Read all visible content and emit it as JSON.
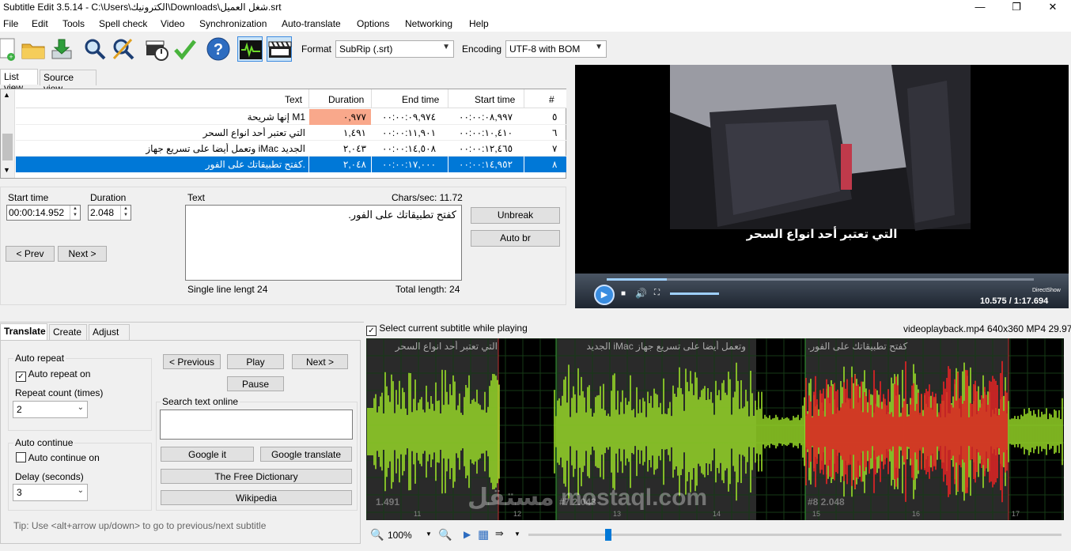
{
  "window": {
    "title": "Subtitle Edit 3.5.14 - C:\\Users\\الكترونيك\\Downloads\\شغل العميل.srt",
    "controls": [
      "—",
      "❐",
      "✕"
    ]
  },
  "menu": [
    "File",
    "Edit",
    "Tools",
    "Spell check",
    "Video",
    "Synchronization",
    "Auto-translate",
    "Options",
    "Networking",
    "Help"
  ],
  "toolbar": {
    "format_label": "Format",
    "format_value": "SubRip (.srt)",
    "encoding_label": "Encoding",
    "encoding_value": "UTF-8 with BOM"
  },
  "view_tabs": [
    "List view",
    "Source view"
  ],
  "grid": {
    "columns": [
      "#",
      "Start time",
      "End time",
      "Duration",
      "Text"
    ],
    "rows": [
      {
        "num": "٥",
        "start": "٠٠:٠٠:٠٨,٩٩٧",
        "end": "٠٠:٠٠:٠٩,٩٧٤",
        "duration": "٠,٩٧٧",
        "text": "إنها شريحة M1",
        "warn": true,
        "selected": false
      },
      {
        "num": "٦",
        "start": "٠٠:٠٠:١٠,٤١٠",
        "end": "٠٠:٠٠:١١,٩٠١",
        "duration": "١,٤٩١",
        "text": "التي تعتبر أحد انواع السحر",
        "warn": false,
        "selected": false
      },
      {
        "num": "٧",
        "start": "٠٠:٠٠:١٢,٤٦٥",
        "end": "٠٠:٠٠:١٤,٥٠٨",
        "duration": "٢,٠٤٣",
        "text": "وتعمل أيضا على تسريع جهاز iMac الجديد",
        "warn": false,
        "selected": false
      },
      {
        "num": "٨",
        "start": "٠٠:٠٠:١٤,٩٥٢",
        "end": "٠٠:٠٠:١٧,٠٠٠",
        "duration": "٢,٠٤٨",
        "text": "كفتح تطبيقاتك على الفور.",
        "warn": false,
        "selected": true
      }
    ]
  },
  "editor": {
    "start_label": "Start time",
    "start_value": "00:00:14.952",
    "duration_label": "Duration",
    "duration_value": "2.048",
    "text_label": "Text",
    "chars_sec": "Chars/sec: 11.72",
    "text_value": "كفتح تطبيقاتك على الفور.",
    "single_line": "Single line lengt 24",
    "total_length": "Total length: 24",
    "prev_label": "< Prev",
    "next_label": "Next >",
    "unbreak_label": "Unbreak",
    "autobr_label": "Auto br"
  },
  "video": {
    "subtitle": "التي تعتبر أحد انواع السحر",
    "time": "10.575 / 1:17.694",
    "engine": "DirectShow"
  },
  "bottom_tabs": [
    "Translate",
    "Create",
    "Adjust"
  ],
  "translate": {
    "auto_repeat_group": "Auto repeat",
    "auto_repeat_on": "Auto repeat on",
    "repeat_count_label": "Repeat count (times)",
    "repeat_count_value": "2",
    "auto_continue_group": "Auto continue",
    "auto_continue_on": "Auto continue on",
    "delay_label": "Delay (seconds)",
    "delay_value": "3",
    "previous_label": "< Previous",
    "play_label": "Play",
    "next_label": "Next >",
    "pause_label": "Pause",
    "search_group": "Search text online",
    "google_it": "Google it",
    "google_translate": "Google translate",
    "free_dictionary": "The Free Dictionary",
    "wikipedia": "Wikipedia",
    "tip": "Tip: Use <alt+arrow up/down> to go to previous/next subtitle"
  },
  "waveform": {
    "select_current": "Select current subtitle while playing",
    "file_info": "videoplayback.mp4 640x360 MP4 29.97",
    "seg_texts": [
      "التي تعتبر أحد انواع السحر",
      "وتعمل أيضا على تسريع جهاز iMac الجديد",
      "كفتح تطبيقاتك على الفور."
    ],
    "seg_labels": [
      "1.491",
      "#7  2.043",
      "#8  2.048"
    ],
    "ticks": [
      "11",
      "12",
      "13",
      "14",
      "15",
      "16",
      "17"
    ],
    "zoom": "100%"
  },
  "watermark": "مستقل mostaql.com",
  "colors": {
    "selected_row": "#0078d7",
    "duration_warn": "#f9a88b",
    "wave_green": "#9bde28",
    "wave_red": "#ea2424",
    "accent": "#3a8de0"
  }
}
